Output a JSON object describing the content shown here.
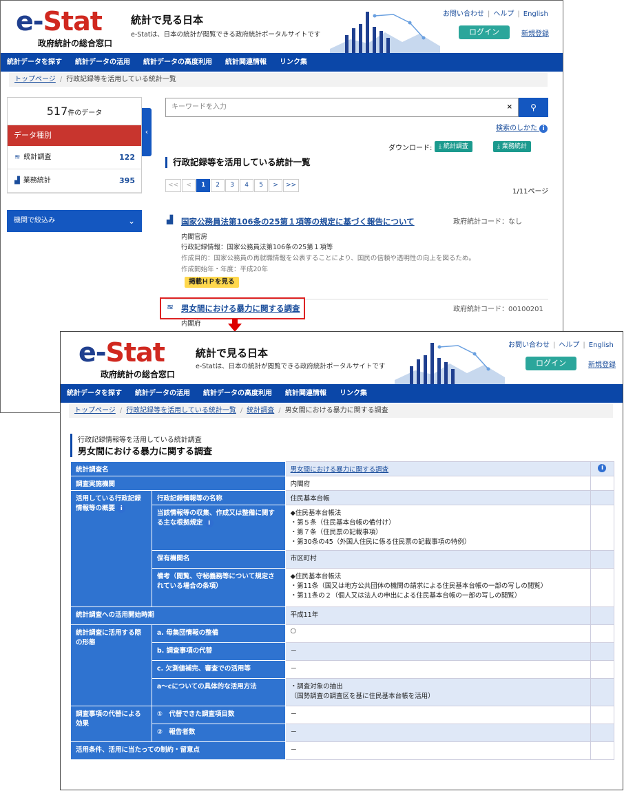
{
  "header": {
    "logo_e": "e-",
    "logo_stat": "Stat",
    "logo_sub": "政府統計の総合窓口",
    "title": "統計で見る日本",
    "desc": "e-Statは、日本の統計が閲覧できる政府統計ポータルサイトです",
    "util": [
      "お問い合わせ",
      "ヘルプ",
      "English"
    ],
    "login": "ログイン",
    "register": "新規登録"
  },
  "nav": [
    "統計データを探す",
    "統計データの活用",
    "統計データの高度利用",
    "統計関連情報",
    "リンク集"
  ],
  "shot1": {
    "breadcrumb": [
      "トップページ",
      "行政記録等を活用している統計一覧"
    ],
    "count": "517",
    "count_unit": "件のデータ",
    "data_type_label": "データ種別",
    "rows": [
      {
        "label": "統計調査",
        "count": "122"
      },
      {
        "label": "業務統計",
        "count": "395"
      }
    ],
    "filter_label": "機関で絞込み",
    "search_placeholder": "キーワードを入力",
    "search_howto": "検索のしかた",
    "download_label": "ダウンロード:",
    "dl_survey": "統計調査",
    "dl_business": "業務統計",
    "heading": "行政記録等を活用している統計一覧",
    "pager": [
      "<<",
      "<",
      "1",
      "2",
      "3",
      "4",
      "5",
      ">",
      ">>"
    ],
    "page_of": "1/11ページ",
    "item1": {
      "title": "国家公務員法第106条の25第１項等の規定に基づく報告について",
      "code": "政府統計コード：なし",
      "org": "内閣官房",
      "record": "行政記録情報：国家公務員法第106条の25第１項等",
      "purpose": "作成目的：国家公務員の再就職情報を公表することにより、国民の信頼や透明性の向上を図るため。",
      "start": "作成開始年・年度：平成20年",
      "hp": "掲載ＨＰを見る"
    },
    "item2": {
      "title": "男女間における暴力に関する調査",
      "code": "政府統計コード：00100201",
      "org": "内閣府"
    }
  },
  "shot2": {
    "breadcrumb": [
      "トップページ",
      "行政記録等を活用している統計一覧",
      "統計調査",
      "男女間における暴力に関する調査"
    ],
    "subtitle": "行政記録情報等を活用している統計調査",
    "title": "男女間における暴力に関する調査",
    "rows": {
      "r1": {
        "h": "統計調査名",
        "v": "男女間における暴力に関する調査"
      },
      "r2": {
        "h": "調査実施機関",
        "v": "内閣府"
      },
      "r3": {
        "h": "活用している行政記録情報等の概要",
        "s1": "行政記録情報等の名称",
        "v1": "住民基本台帳",
        "s2": "当該情報等の収集、作成又は整備に関する主な根拠規定",
        "v2": "◆住民基本台帳法\n・第５条（住民基本台帳の備付け）\n・第７条（住民票の記載事項）\n・第30条の45（外国人住民に係る住民票の記載事項の特例）",
        "s3": "保有機関名",
        "v3": "市区町村",
        "s4": "備考（閲覧、守秘義務等について規定されている場合の条項）",
        "v4": "◆住民基本台帳法\n・第11条（国又は地方公共団体の機関の請求による住民基本台帳の一部の写しの閲覧）\n・第11条の２（個人又は法人の申出による住民基本台帳の一部の写しの閲覧）"
      },
      "r4": {
        "h": "統計調査への活用開始時期",
        "v": "平成11年"
      },
      "r5": {
        "h": "統計調査に活用する際の形態",
        "s1": "a. 母集団情報の整備",
        "v1": "○",
        "s2": "b. 調査事項の代替",
        "v2": "－",
        "s3": "c. 欠測値補完、審査での活用等",
        "v3": "－",
        "s4": "a～cについての具体的な活用方法",
        "v4": "・調査対象の抽出\n（国勢調査の調査区を基に住民基本台帳を活用）"
      },
      "r6": {
        "h": "調査事項の代替による効果",
        "s1": "①　代替できた調査項目数",
        "v1": "－",
        "s2": "②　報告者数",
        "v2": "－"
      },
      "r7": {
        "h": "活用条件、活用に当たっての制約・留意点",
        "v": "－"
      }
    }
  },
  "colors": {
    "nav": "#0b47a8",
    "accent": "#2ba69b",
    "red": "#c8352e",
    "table_head": "#2f73d0"
  },
  "icons": [
    "search-icon",
    "close-icon",
    "info-icon",
    "chevron-left-icon",
    "chevron-down-icon",
    "download-icon",
    "survey-icon",
    "business-stat-icon",
    "down-arrow-icon"
  ]
}
